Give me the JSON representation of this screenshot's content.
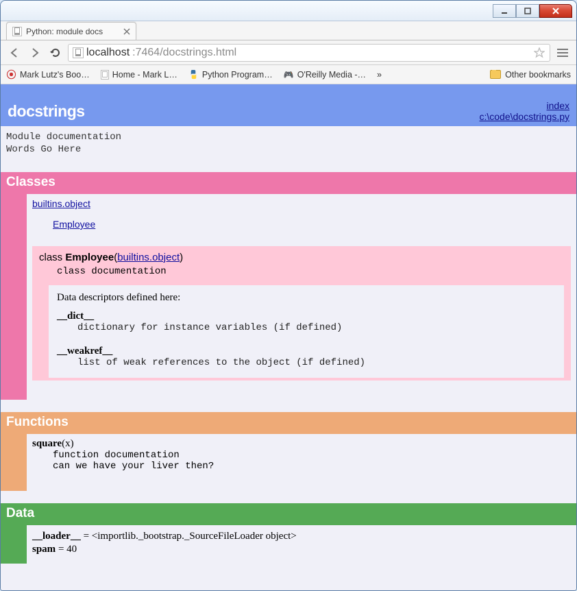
{
  "window": {
    "tab_title": "Python: module docs",
    "url_host": "localhost",
    "url_port_path": ":7464/docstrings.html"
  },
  "bookmarks": {
    "items": [
      {
        "label": "Mark Lutz's Boo…"
      },
      {
        "label": "Home - Mark L…"
      },
      {
        "label": "Python Program…"
      },
      {
        "label": "O'Reilly Media -…"
      }
    ],
    "overflow": "»",
    "other": "Other bookmarks"
  },
  "module": {
    "name": "docstrings",
    "index_label": "index",
    "path": "c:\\code\\docstrings.py",
    "doc_line1": "Module documentation",
    "doc_line2": "Words Go Here"
  },
  "classes": {
    "heading": "Classes",
    "base_link": "builtins.object",
    "child_link": "Employee",
    "block": {
      "prefix": "class ",
      "name": "Employee",
      "base": "builtins.object",
      "doc": "class documentation",
      "descriptors_title": "Data descriptors defined here:",
      "dict_name": "__dict__",
      "dict_doc": "dictionary for instance variables (if defined)",
      "weakref_name": "__weakref__",
      "weakref_doc": "list of weak references to the object (if defined)"
    }
  },
  "functions": {
    "heading": "Functions",
    "name": "square",
    "args": "(x)",
    "doc_line1": "function documentation",
    "doc_line2": "can we have your liver then?"
  },
  "data_section": {
    "heading": "Data",
    "loader_name": "__loader__",
    "loader_value": " = <importlib._bootstrap._SourceFileLoader object>",
    "spam_name": "spam",
    "spam_value": " = 40"
  }
}
